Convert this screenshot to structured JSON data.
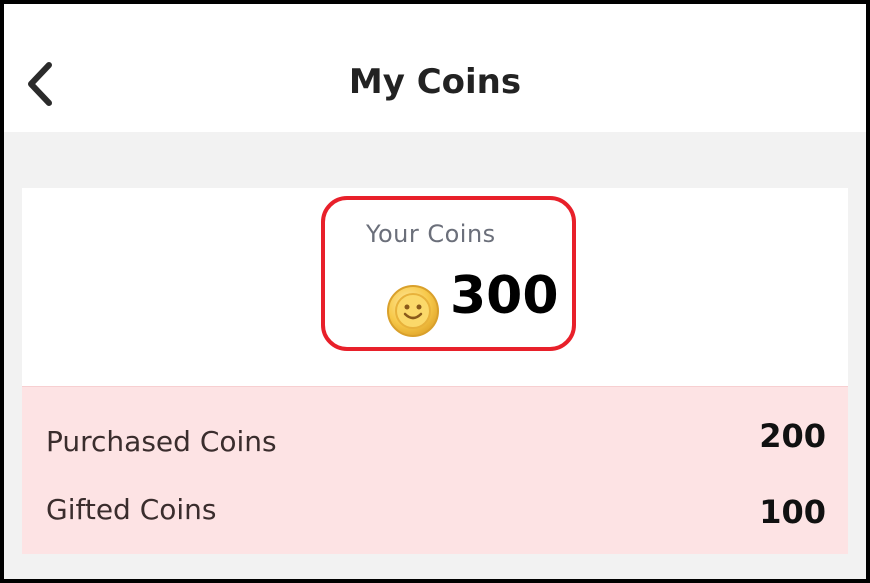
{
  "header": {
    "title": "My Coins",
    "back_icon": "chevron-left-icon"
  },
  "balance": {
    "label": "Your Coins",
    "total": "300",
    "coin_icon": "coin-icon",
    "highlight_color": "#e8202a"
  },
  "breakdown": {
    "rows": [
      {
        "label": "Purchased Coins",
        "value": "200"
      },
      {
        "label": "Gifted Coins",
        "value": "100"
      }
    ],
    "background": "#fde3e4"
  }
}
